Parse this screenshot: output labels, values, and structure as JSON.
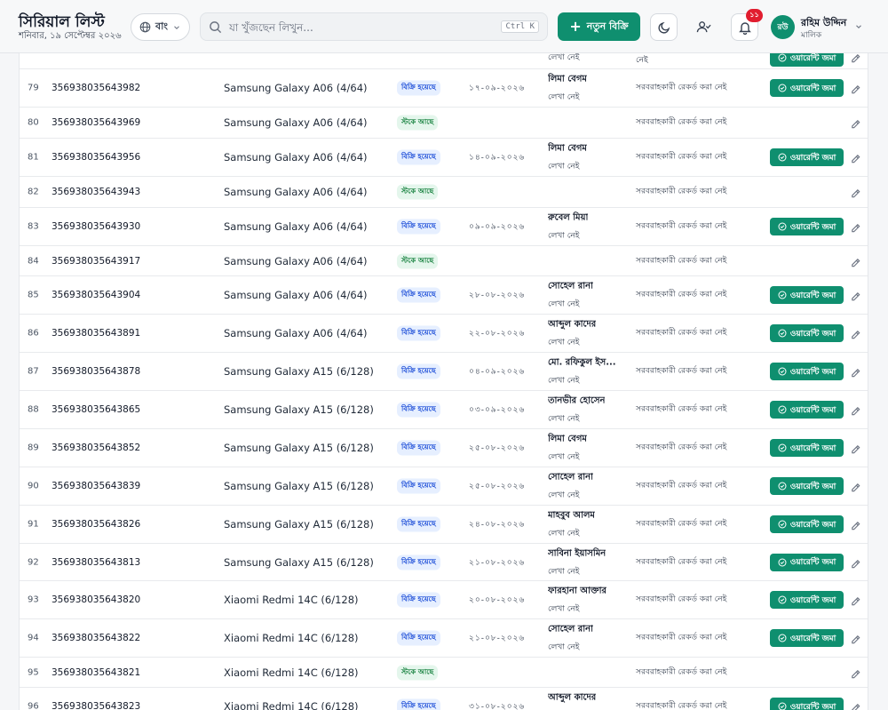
{
  "header": {
    "title": "সিরিয়াল লিস্ট",
    "date": "শনিবার, ১৯ সেপ্টেম্বর ২০২৬",
    "lang_label": "বাং",
    "search_placeholder": "যা খুঁজছেন লিখুন...",
    "search_shortcut": "Ctrl K",
    "new_sale_label": "নতুন বিক্রি",
    "notification_count": "১১",
    "user_initials": "রউ",
    "user_name": "রহিম উদ্দিন",
    "user_role": "মালিক"
  },
  "labels": {
    "sold": "বিক্রি হয়েছে",
    "in_stock": "স্টকে আছে",
    "no_note": "লেখা নেই",
    "supplier_none": "সরবরাহকারী রেকর্ড করা নেই",
    "warranty_btn": "ওয়ারেন্টি জমা"
  },
  "rows": [
    {
      "no": "",
      "imei": "",
      "model": "",
      "status": "",
      "date": "",
      "customer": "",
      "note": "লেখা নেই",
      "supplier": "নেই",
      "warranty": true
    },
    {
      "no": "79",
      "imei": "356938035643982",
      "model": "Samsung Galaxy A06 (4/64)",
      "status": "sold",
      "date": "১৭-০৯-২০২৬",
      "customer": "লিমা বেগম",
      "note": "লেখা নেই",
      "supplier": "সরবরাহকারী রেকর্ড করা নেই",
      "warranty": true
    },
    {
      "no": "80",
      "imei": "356938035643969",
      "model": "Samsung Galaxy A06 (4/64)",
      "status": "stock",
      "date": "",
      "customer": "",
      "note": "",
      "supplier": "সরবরাহকারী রেকর্ড করা নেই",
      "warranty": false
    },
    {
      "no": "81",
      "imei": "356938035643956",
      "model": "Samsung Galaxy A06 (4/64)",
      "status": "sold",
      "date": "১৪-০৯-২০২৬",
      "customer": "লিমা বেগম",
      "note": "লেখা নেই",
      "supplier": "সরবরাহকারী রেকর্ড করা নেই",
      "warranty": true
    },
    {
      "no": "82",
      "imei": "356938035643943",
      "model": "Samsung Galaxy A06 (4/64)",
      "status": "stock",
      "date": "",
      "customer": "",
      "note": "",
      "supplier": "সরবরাহকারী রেকর্ড করা নেই",
      "warranty": false
    },
    {
      "no": "83",
      "imei": "356938035643930",
      "model": "Samsung Galaxy A06 (4/64)",
      "status": "sold",
      "date": "০৯-০৯-২০২৬",
      "customer": "রুবেল মিয়া",
      "note": "লেখা নেই",
      "supplier": "সরবরাহকারী রেকর্ড করা নেই",
      "warranty": true
    },
    {
      "no": "84",
      "imei": "356938035643917",
      "model": "Samsung Galaxy A06 (4/64)",
      "status": "stock",
      "date": "",
      "customer": "",
      "note": "",
      "supplier": "সরবরাহকারী রেকর্ড করা নেই",
      "warranty": false
    },
    {
      "no": "85",
      "imei": "356938035643904",
      "model": "Samsung Galaxy A06 (4/64)",
      "status": "sold",
      "date": "২৮-০৮-২০২৬",
      "customer": "সোহেল রানা",
      "note": "লেখা নেই",
      "supplier": "সরবরাহকারী রেকর্ড করা নেই",
      "warranty": true
    },
    {
      "no": "86",
      "imei": "356938035643891",
      "model": "Samsung Galaxy A06 (4/64)",
      "status": "sold",
      "date": "২২-০৮-২০২৬",
      "customer": "আব্দুল কাদের",
      "note": "লেখা নেই",
      "supplier": "সরবরাহকারী রেকর্ড করা নেই",
      "warranty": true
    },
    {
      "no": "87",
      "imei": "356938035643878",
      "model": "Samsung Galaxy A15 (6/128)",
      "status": "sold",
      "date": "০৪-০৯-২০২৬",
      "customer": "মো. রফিকুল ইস...",
      "note": "লেখা নেই",
      "supplier": "সরবরাহকারী রেকর্ড করা নেই",
      "warranty": true
    },
    {
      "no": "88",
      "imei": "356938035643865",
      "model": "Samsung Galaxy A15 (6/128)",
      "status": "sold",
      "date": "০৩-০৯-২০২৬",
      "customer": "তানভীর হোসেন",
      "note": "লেখা নেই",
      "supplier": "সরবরাহকারী রেকর্ড করা নেই",
      "warranty": true
    },
    {
      "no": "89",
      "imei": "356938035643852",
      "model": "Samsung Galaxy A15 (6/128)",
      "status": "sold",
      "date": "২৫-০৮-২০২৬",
      "customer": "লিমা বেগম",
      "note": "লেখা নেই",
      "supplier": "সরবরাহকারী রেকর্ড করা নেই",
      "warranty": true
    },
    {
      "no": "90",
      "imei": "356938035643839",
      "model": "Samsung Galaxy A15 (6/128)",
      "status": "sold",
      "date": "২৫-০৮-২০২৬",
      "customer": "সোহেল রানা",
      "note": "লেখা নেই",
      "supplier": "সরবরাহকারী রেকর্ড করা নেই",
      "warranty": true
    },
    {
      "no": "91",
      "imei": "356938035643826",
      "model": "Samsung Galaxy A15 (6/128)",
      "status": "sold",
      "date": "২৪-০৮-২০২৬",
      "customer": "মাহবুব আলম",
      "note": "লেখা নেই",
      "supplier": "সরবরাহকারী রেকর্ড করা নেই",
      "warranty": true
    },
    {
      "no": "92",
      "imei": "356938035643813",
      "model": "Samsung Galaxy A15 (6/128)",
      "status": "sold",
      "date": "২১-০৮-২০২৬",
      "customer": "সাবিনা ইয়াসমিন",
      "note": "লেখা নেই",
      "supplier": "সরবরাহকারী রেকর্ড করা নেই",
      "warranty": true
    },
    {
      "no": "93",
      "imei": "356938035643820",
      "model": "Xiaomi Redmi 14C (6/128)",
      "status": "sold",
      "date": "২০-০৮-২০২৬",
      "customer": "ফারহানা আক্তার",
      "note": "লেখা নেই",
      "supplier": "সরবরাহকারী রেকর্ড করা নেই",
      "warranty": true
    },
    {
      "no": "94",
      "imei": "356938035643822",
      "model": "Xiaomi Redmi 14C (6/128)",
      "status": "sold",
      "date": "২১-০৮-২০২৬",
      "customer": "সোহেল রানা",
      "note": "লেখা নেই",
      "supplier": "সরবরাহকারী রেকর্ড করা নেই",
      "warranty": true
    },
    {
      "no": "95",
      "imei": "356938035643821",
      "model": "Xiaomi Redmi 14C (6/128)",
      "status": "stock",
      "date": "",
      "customer": "",
      "note": "",
      "supplier": "সরবরাহকারী রেকর্ড করা নেই",
      "warranty": false
    },
    {
      "no": "96",
      "imei": "356938035643823",
      "model": "Xiaomi Redmi 14C (6/128)",
      "status": "sold",
      "date": "৩১-০৮-২০২৬",
      "customer": "আব্দুল কাদের",
      "note": "লেখা নেই",
      "supplier": "সরবরাহকারী রেকর্ড করা নেই",
      "warranty": true
    }
  ]
}
